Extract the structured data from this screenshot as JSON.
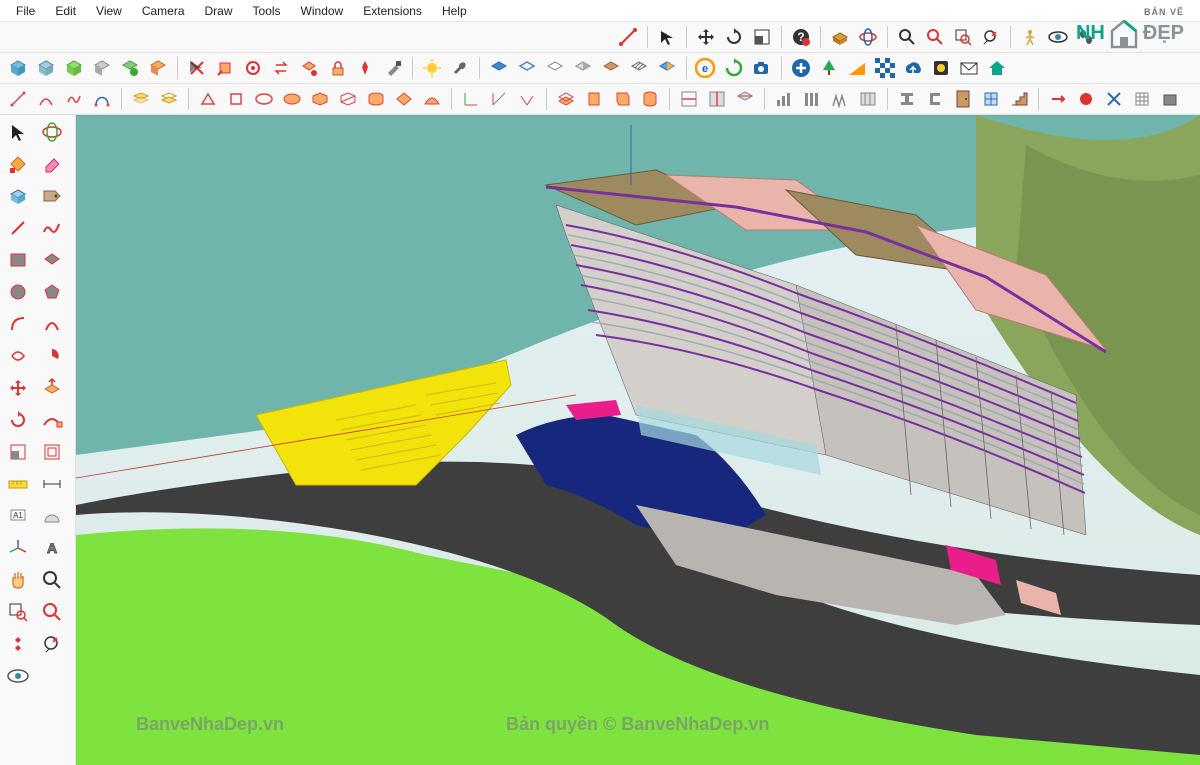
{
  "menu": {
    "items": [
      "File",
      "Edit",
      "View",
      "Camera",
      "Draw",
      "Tools",
      "Window",
      "Extensions",
      "Help"
    ]
  },
  "toolbar1": {
    "icons": [
      "edge",
      "line",
      "arrow",
      "move",
      "rotate",
      "scale",
      "help",
      "push",
      "rotate2",
      "zoom",
      "zoom-extents",
      "zoom-window",
      "zoom-prev",
      "walk",
      "look",
      "footprints"
    ]
  },
  "toolbar2": {
    "icons": [
      "box1",
      "box2",
      "box3",
      "box4",
      "box5",
      "box6",
      "edit-grp",
      "cut",
      "copy",
      "paste",
      "paint",
      "sample",
      "sun",
      "wrench",
      "blank",
      "layer1",
      "layer2",
      "layer3",
      "layer4",
      "layer5",
      "layer6",
      "layer7",
      "render",
      "refresh",
      "camera",
      "plus",
      "tree",
      "slope",
      "checker",
      "cloud",
      "plugin",
      "mail",
      "home"
    ]
  },
  "toolbar3": {
    "icons": [
      "t1",
      "t2",
      "t3",
      "t4",
      "t5",
      "t6",
      "t7",
      "t8",
      "t9",
      "t10",
      "t11",
      "t12",
      "t13",
      "t14",
      "t15",
      "t16",
      "t17",
      "t18",
      "t19",
      "t20",
      "t21",
      "t22",
      "t23",
      "t24",
      "t25",
      "t26",
      "t27",
      "t28",
      "t29",
      "t30",
      "t31",
      "t32",
      "t33",
      "t34",
      "t35",
      "t36",
      "t37",
      "t38",
      "t39"
    ]
  },
  "side": {
    "icons": [
      "select",
      "orbit",
      "paint",
      "eraser",
      "component",
      "tag",
      "line",
      "freehand",
      "rect",
      "rect2",
      "circle",
      "polygon",
      "arc",
      "arc2",
      "arc3",
      "arc4",
      "move-s",
      "pushpull",
      "rotate-s",
      "followme",
      "scale-s",
      "offset",
      "tape",
      "dim",
      "protractor",
      "text",
      "axes",
      "3dtext",
      "pan",
      "zoom-s",
      "orbit-s",
      "walk-s",
      "look-s",
      "prev",
      "eye"
    ]
  },
  "logo": {
    "brand_left": "NH",
    "brand_right": "ĐẸP",
    "brand_top": "BẢN VẼ"
  },
  "watermarks": {
    "left": "BanveNhaDep.vn",
    "right": "Bản quyền © BanveNhaDep.vn"
  },
  "colors": {
    "water": "#6fb5ab",
    "grass": "#7ee23f",
    "hill": "#8aa65c",
    "road": "#3e3e3e",
    "parking": "#f2e40a",
    "navy": "#17277d",
    "pink": "#e91e8a",
    "roof_tan": "#9d8a5e",
    "roof_pink": "#e9b4a9",
    "purple": "#7a2fa0"
  }
}
